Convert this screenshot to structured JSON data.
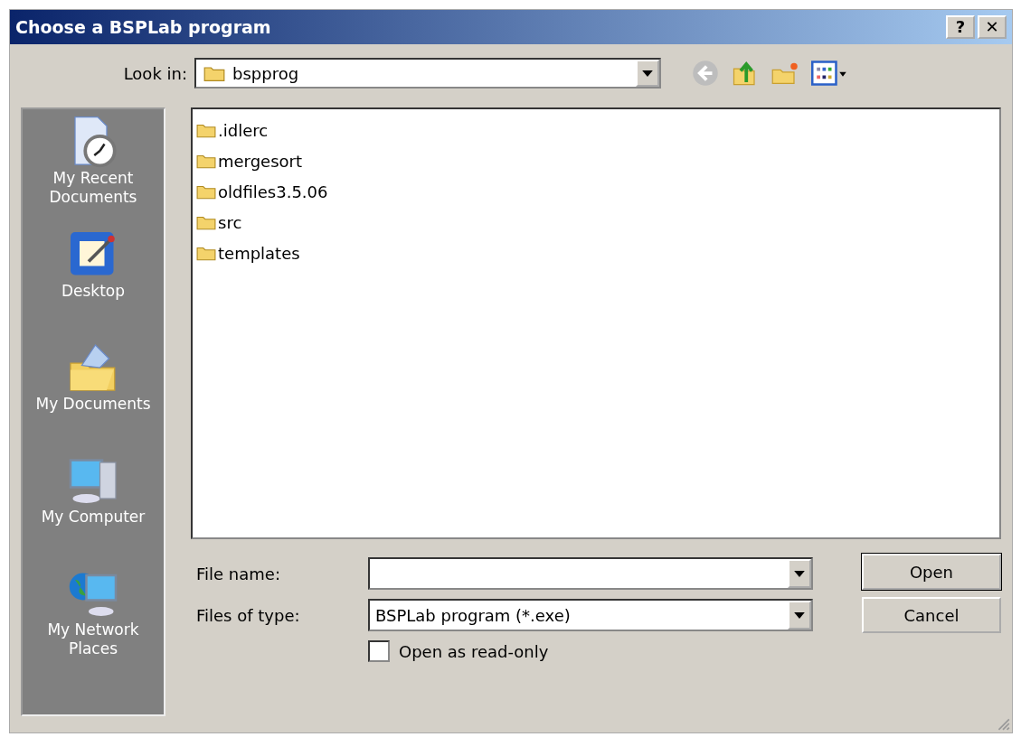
{
  "window": {
    "title": "Choose a BSPLab program",
    "title_buttons": [
      "?",
      "✕"
    ]
  },
  "look_in": {
    "label": "Look in:",
    "value": "bspprog"
  },
  "places": [
    {
      "kind": "recent",
      "label": "My Recent Documents"
    },
    {
      "kind": "desktop",
      "label": "Desktop"
    },
    {
      "kind": "documents",
      "label": "My Documents"
    },
    {
      "kind": "computer",
      "label": "My Computer"
    },
    {
      "kind": "network",
      "label": "My Network Places"
    }
  ],
  "files": [
    {
      "name": ".idlerc"
    },
    {
      "name": "mergesort"
    },
    {
      "name": "oldfiles3.5.06"
    },
    {
      "name": "src"
    },
    {
      "name": "templates"
    }
  ],
  "file_name": {
    "label": "File name:"
  },
  "file_type": {
    "label": "Files of type:",
    "value": "BSPLab program (*.exe)"
  },
  "read_only": {
    "label": "Open as read-only",
    "checked": false
  },
  "buttons": [
    {
      "label": "Open",
      "default": true
    },
    {
      "label": "Cancel",
      "default": false
    }
  ]
}
